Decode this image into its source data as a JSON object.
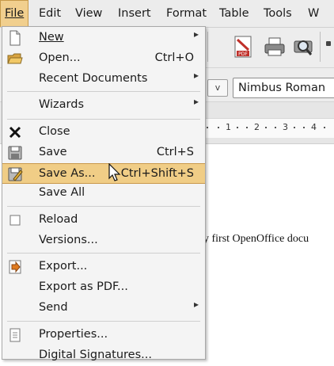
{
  "menubar": {
    "items": [
      {
        "label": "File"
      },
      {
        "label": "Edit"
      },
      {
        "label": "View"
      },
      {
        "label": "Insert"
      },
      {
        "label": "Format"
      },
      {
        "label": "Table"
      },
      {
        "label": "Tools"
      },
      {
        "label": "W"
      }
    ]
  },
  "toolbar": {
    "font_name": "Nimbus Roman",
    "size_dropdown_symbol": "v",
    "pdf_label": "PDF"
  },
  "ruler": {
    "labels": [
      "1",
      "2",
      "3",
      "4"
    ]
  },
  "document": {
    "text": "y first OpenOffice docu"
  },
  "file_menu": {
    "new": {
      "label": "New"
    },
    "open": {
      "label": "Open...",
      "shortcut": "Ctrl+O"
    },
    "recent": {
      "label": "Recent Documents"
    },
    "wizards": {
      "label": "Wizards"
    },
    "close": {
      "label": "Close"
    },
    "save": {
      "label": "Save",
      "shortcut": "Ctrl+S"
    },
    "save_as": {
      "label": "Save As...",
      "shortcut": "Ctrl+Shift+S"
    },
    "save_all": {
      "label": "Save All"
    },
    "reload": {
      "label": "Reload"
    },
    "versions": {
      "label": "Versions..."
    },
    "export": {
      "label": "Export..."
    },
    "export_pdf": {
      "label": "Export as PDF..."
    },
    "send": {
      "label": "Send"
    },
    "properties": {
      "label": "Properties..."
    },
    "digital_signatures": {
      "label": "Digital Signatures..."
    }
  },
  "colors": {
    "highlight": "#f0cd86",
    "highlight_border": "#c9984b",
    "menu_bg": "#f4f4f4"
  }
}
